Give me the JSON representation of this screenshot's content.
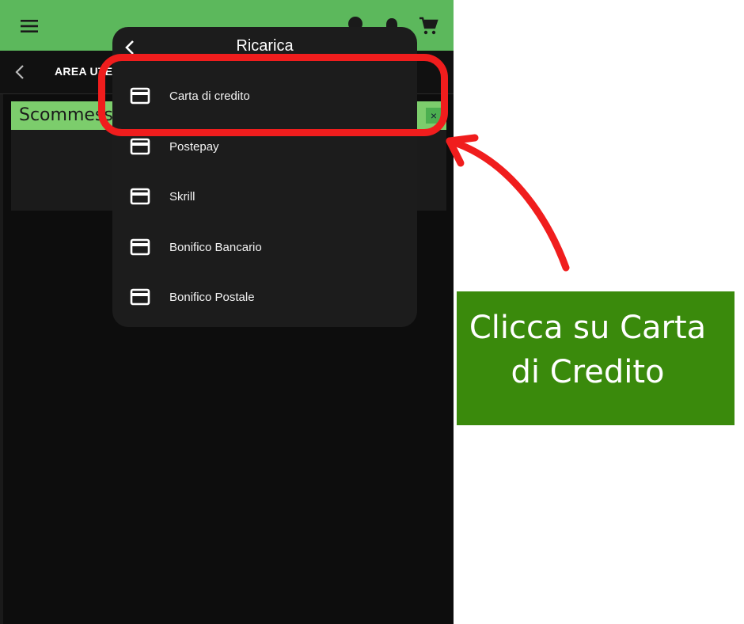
{
  "header": {
    "subbar_title": "AREA UTENTE"
  },
  "card": {
    "banner_text": "Scommesse",
    "close_symbol": "×"
  },
  "popup": {
    "title": "Ricarica",
    "methods": [
      {
        "label": "Carta di credito",
        "icon": "credit-card-icon"
      },
      {
        "label": "Postepay",
        "icon": "credit-card-icon"
      },
      {
        "label": "Skrill",
        "icon": "credit-card-icon"
      },
      {
        "label": "Bonifico Bancario",
        "icon": "credit-card-icon"
      },
      {
        "label": "Bonifico Postale",
        "icon": "credit-card-icon"
      }
    ]
  },
  "annotation": {
    "callout_line1": "Clicca su Carta",
    "callout_line2": "di Credito",
    "highlight_color": "#f01d1d",
    "callout_color": "#3a8a0c"
  },
  "colors": {
    "topbar": "#5cb85c",
    "background": "#0d0d0d",
    "popup": "#1c1c1c"
  },
  "icons": [
    "menu-icon",
    "user-icon",
    "bell-icon",
    "cart-icon",
    "back-icon",
    "credit-card-icon"
  ]
}
